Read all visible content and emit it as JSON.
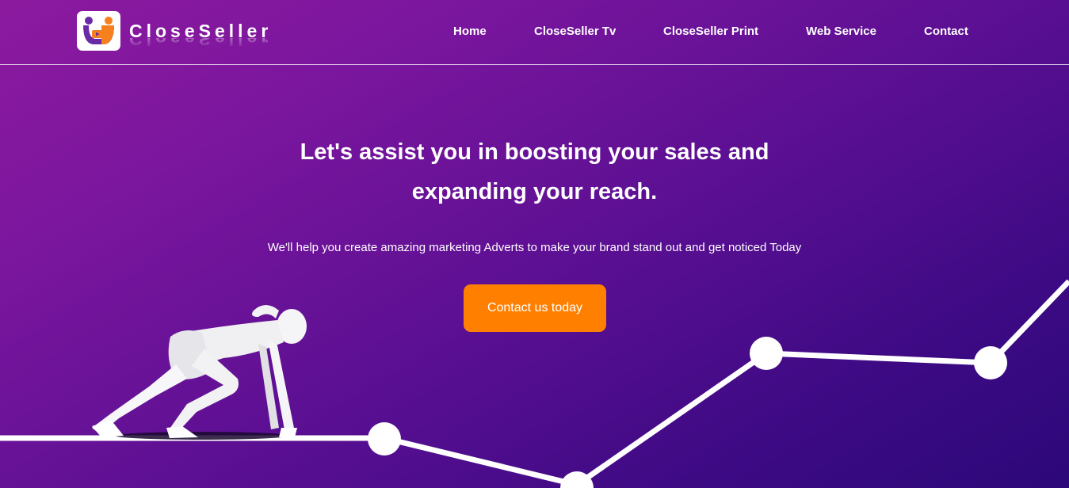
{
  "brand": {
    "name": "CloseSeller",
    "logo_icon": "shopping-bag-video-logo",
    "colors": {
      "logo_orange": "#f7801e",
      "logo_purple": "#6a2aa6"
    }
  },
  "nav": {
    "items": [
      {
        "label": "Home"
      },
      {
        "label": "CloseSeller Tv"
      },
      {
        "label": "CloseSeller Print"
      },
      {
        "label": "Web Service"
      },
      {
        "label": "Contact"
      }
    ]
  },
  "hero": {
    "title_line1": "Let's assist you in boosting your sales and",
    "title_line2": "expanding your reach.",
    "subtitle": "We'll help you create amazing marketing Adverts to make your brand stand out and get noticed Today",
    "cta_label": "Contact us today",
    "illustration": "runner-at-starting-line-on-growth-chart"
  },
  "colors": {
    "background_start": "#8c1a9f",
    "background_end": "#2c087a",
    "cta_background": "#ff8000",
    "text": "#ffffff"
  }
}
